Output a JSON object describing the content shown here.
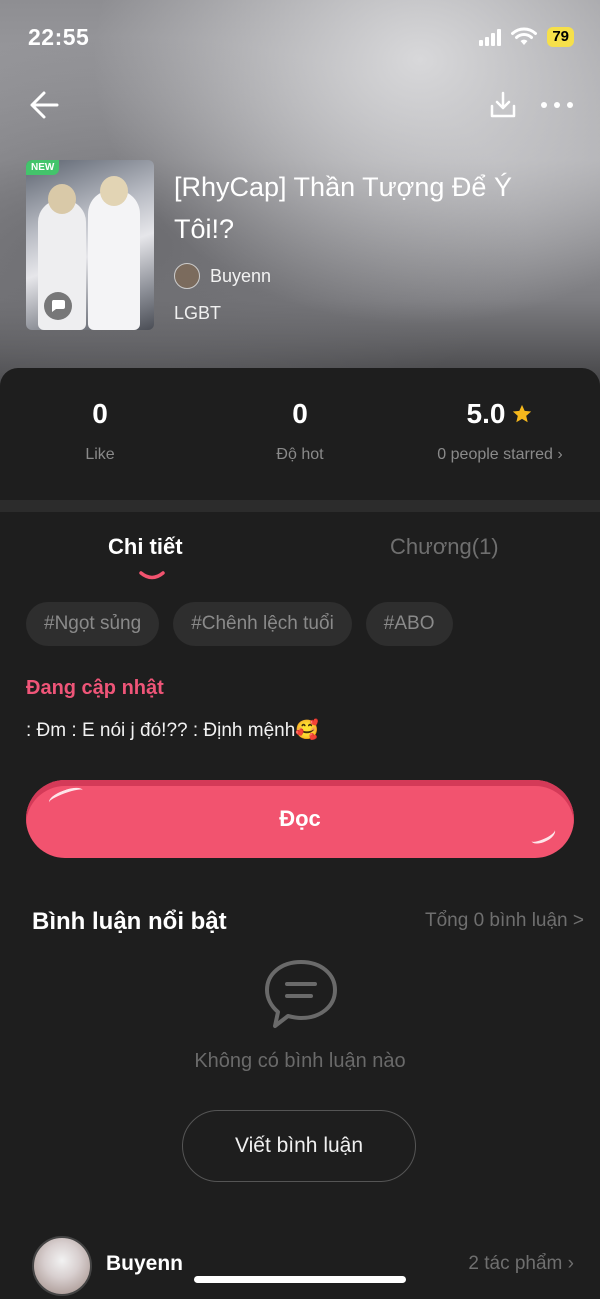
{
  "status_bar": {
    "time": "22:55",
    "battery": "79"
  },
  "book": {
    "badge": "NEW",
    "title": "[RhyCap] Thần Tượng Để Ý Tôi!?",
    "author": "Buyenn",
    "genre": "LGBT"
  },
  "stats": [
    {
      "value": "0",
      "label": "Like"
    },
    {
      "value": "0",
      "label": "Độ hot"
    },
    {
      "value": "5.0",
      "label": "0 people starred ›"
    }
  ],
  "tabs": {
    "detail": "Chi tiết",
    "chapters": "Chương(1)"
  },
  "tags": [
    "#Ngọt sủng",
    "#Chênh lệch tuổi",
    "#ABO"
  ],
  "status_text": "Đang cập nhật",
  "description": ": Đm : E nói j đó!?? : Định mệnh🥰",
  "read_button": "Đọc",
  "comments": {
    "title": "Bình luận nổi bật",
    "total": "Tổng 0 bình luận >",
    "empty": "Không có bình luận nào",
    "write_button": "Viết bình luận"
  },
  "author_row": {
    "name": "Buyenn",
    "works": "2 tác phẩm ›"
  },
  "colors": {
    "accent": "#f2536f",
    "status": "#ef5578",
    "star": "#f5b81c"
  }
}
